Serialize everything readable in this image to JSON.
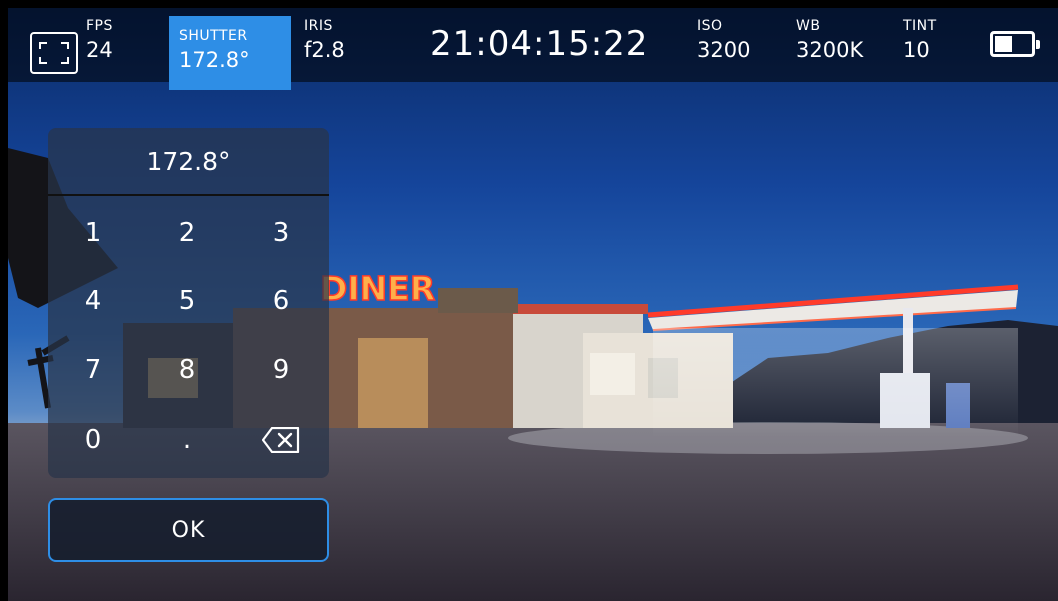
{
  "header": {
    "fps": {
      "label": "FPS",
      "value": "24"
    },
    "shutter": {
      "label": "SHUTTER",
      "value": "172.8°"
    },
    "iris": {
      "label": "IRIS",
      "value": "f2.8"
    },
    "timecode": "21:04:15:22",
    "iso": {
      "label": "ISO",
      "value": "3200"
    },
    "wb": {
      "label": "WB",
      "value": "3200K"
    },
    "tint": {
      "label": "TINT",
      "value": "10"
    },
    "battery_level": 0.45
  },
  "icons": {
    "frame_guides": "frame-guides-icon",
    "battery": "battery-icon",
    "backspace": "backspace-icon"
  },
  "keypad": {
    "display": "172.8°",
    "keys": [
      "1",
      "2",
      "3",
      "4",
      "5",
      "6",
      "7",
      "8",
      "9",
      "0",
      ".",
      ""
    ],
    "ok_label": "OK"
  },
  "scene": {
    "sign_text": "DINER"
  },
  "colors": {
    "accent": "#2e8ee6",
    "neon": "#ff3b2a"
  }
}
